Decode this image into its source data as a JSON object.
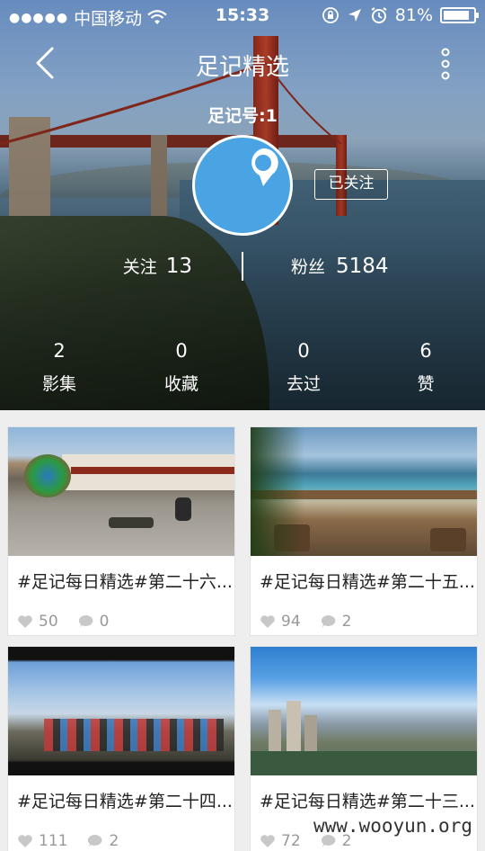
{
  "status_bar": {
    "signal_dots": "●●●●●",
    "carrier": "中国移动",
    "time": "15:33",
    "battery": "81%",
    "battery_level_percent": 81,
    "icons": [
      "wifi-icon",
      "orientation-lock-icon",
      "location-arrow-icon",
      "alarm-icon",
      "battery-icon"
    ]
  },
  "nav": {
    "title": "足记精选",
    "back_icon": "chevron-left-icon",
    "more_icon": "vertical-dots-icon"
  },
  "profile": {
    "id_label": "足记号:1",
    "avatar_icon": "location-pin-icon",
    "avatar_color": "#4aa3e3",
    "follow_status": "已关注",
    "following_label": "关注",
    "following_count": "13",
    "fans_label": "粉丝",
    "fans_count": "5184"
  },
  "counts": [
    {
      "value": "2",
      "label": "影集"
    },
    {
      "value": "0",
      "label": "收藏"
    },
    {
      "value": "0",
      "label": "去过"
    },
    {
      "value": "6",
      "label": "赞"
    }
  ],
  "cards": [
    {
      "title": "#足记每日精选#第二十六...",
      "likes": "50",
      "comments": "0"
    },
    {
      "title": "#足记每日精选#第二十五...",
      "likes": "94",
      "comments": "2"
    },
    {
      "title": "#足记每日精选#第二十四...",
      "likes": "111",
      "comments": "2"
    },
    {
      "title": "#足记每日精选#第二十三...",
      "likes": "72",
      "comments": "2"
    }
  ],
  "watermark": "www.wooyun.org"
}
